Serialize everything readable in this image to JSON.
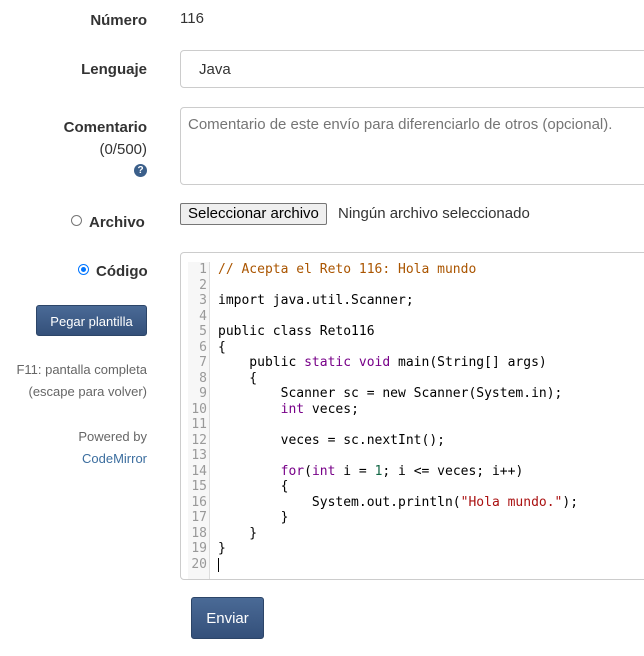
{
  "form": {
    "numero_label": "Número",
    "numero_value": "116",
    "lenguaje_label": "Lenguaje",
    "lenguaje_value": "Java",
    "comentario_label": "Comentario",
    "comentario_counter": "(0/500)",
    "comentario_placeholder": "Comentario de este envío para diferenciarlo de otros (opcional).",
    "help_icon": "question-circle-icon",
    "archivo_label": "Archivo",
    "archivo_button": "Seleccionar archivo",
    "archivo_status": "Ningún archivo seleccionado",
    "codigo_label": "Código",
    "source_mode": "codigo",
    "pegar_plantilla": "Pegar plantilla",
    "f11_hint_line1": "F11: pantalla completa",
    "f11_hint_line2": "(escape para volver)",
    "powered_by": "Powered by",
    "codemirror_link": "CodeMirror",
    "submit_label": "Enviar"
  },
  "colors": {
    "button_bg": "#3d5a80",
    "link": "#3c6e9f",
    "comment": "#aa5500",
    "keyword": "#770088",
    "number": "#116644",
    "string": "#aa1111"
  },
  "editor": {
    "lines": [
      {
        "n": "1",
        "tokens": [
          {
            "t": "// Acepta el Reto 116: Hola mundo",
            "k": "comment"
          }
        ]
      },
      {
        "n": "2",
        "tokens": []
      },
      {
        "n": "3",
        "tokens": [
          {
            "t": "import java.util.Scanner;",
            "k": "plain"
          }
        ]
      },
      {
        "n": "4",
        "tokens": []
      },
      {
        "n": "5",
        "tokens": [
          {
            "t": "public class Reto116",
            "k": "plain"
          }
        ]
      },
      {
        "n": "6",
        "tokens": [
          {
            "t": "{",
            "k": "plain"
          }
        ]
      },
      {
        "n": "7",
        "tokens": [
          {
            "t": "    public ",
            "k": "plain"
          },
          {
            "t": "static",
            "k": "keyword"
          },
          {
            "t": " ",
            "k": "plain"
          },
          {
            "t": "void",
            "k": "keyword"
          },
          {
            "t": " main(String[] args)",
            "k": "plain"
          }
        ]
      },
      {
        "n": "8",
        "tokens": [
          {
            "t": "    {",
            "k": "plain"
          }
        ]
      },
      {
        "n": "9",
        "tokens": [
          {
            "t": "        Scanner sc = new Scanner(System.in);",
            "k": "plain"
          }
        ]
      },
      {
        "n": "10",
        "tokens": [
          {
            "t": "        ",
            "k": "plain"
          },
          {
            "t": "int",
            "k": "keyword"
          },
          {
            "t": " veces;",
            "k": "plain"
          }
        ]
      },
      {
        "n": "11",
        "tokens": []
      },
      {
        "n": "12",
        "tokens": [
          {
            "t": "        veces = sc.nextInt();",
            "k": "plain"
          }
        ]
      },
      {
        "n": "13",
        "tokens": []
      },
      {
        "n": "14",
        "tokens": [
          {
            "t": "        ",
            "k": "plain"
          },
          {
            "t": "for",
            "k": "keyword"
          },
          {
            "t": "(",
            "k": "plain"
          },
          {
            "t": "int",
            "k": "keyword"
          },
          {
            "t": " i = ",
            "k": "plain"
          },
          {
            "t": "1",
            "k": "number"
          },
          {
            "t": "; i <= veces; i++)",
            "k": "plain"
          }
        ]
      },
      {
        "n": "15",
        "tokens": [
          {
            "t": "        {",
            "k": "plain"
          }
        ]
      },
      {
        "n": "16",
        "tokens": [
          {
            "t": "            System.out.println(",
            "k": "plain"
          },
          {
            "t": "\"Hola mundo.\"",
            "k": "string"
          },
          {
            "t": ");",
            "k": "plain"
          }
        ]
      },
      {
        "n": "17",
        "tokens": [
          {
            "t": "        }",
            "k": "plain"
          }
        ]
      },
      {
        "n": "18",
        "tokens": [
          {
            "t": "    }",
            "k": "plain"
          }
        ]
      },
      {
        "n": "19",
        "tokens": [
          {
            "t": "}",
            "k": "plain"
          }
        ]
      },
      {
        "n": "20",
        "tokens": []
      }
    ]
  }
}
